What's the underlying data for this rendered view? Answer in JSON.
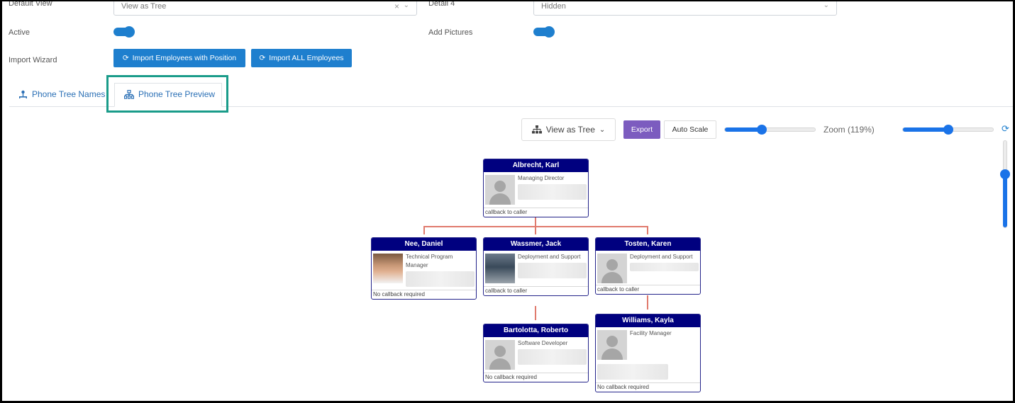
{
  "form": {
    "default_view_label": "Default View",
    "default_view_value": "View as Tree",
    "detail4_label": "Detail 4",
    "detail4_value": "Hidden",
    "active_label": "Active",
    "add_pictures_label": "Add Pictures",
    "import_wizard_label": "Import Wizard",
    "import_position_button": "Import Employees with Position",
    "import_all_button": "Import ALL Employees"
  },
  "tabs": [
    {
      "label": "Phone Tree Names"
    },
    {
      "label": "Phone Tree Preview"
    }
  ],
  "toolbar": {
    "view_label": "View as Tree",
    "export_label": "Export",
    "autoscale_label": "Auto Scale",
    "zoom_label": "Zoom (119%)",
    "zoom_percent": 119
  },
  "org": {
    "karl": {
      "name": "Albrecht, Karl",
      "title": "Managing Director",
      "callback": "callback to caller"
    },
    "daniel": {
      "name": "Nee, Daniel",
      "title": "Technical Program Manager",
      "callback": "No callback required"
    },
    "jack": {
      "name": "Wassmer, Jack",
      "title": "Deployment and Support",
      "callback": "callback to caller"
    },
    "karen": {
      "name": "Tosten, Karen",
      "title": "Deployment and Support",
      "callback": "callback to caller"
    },
    "roberto": {
      "name": "Bartolotta, Roberto",
      "title": "Software Developer",
      "callback": "No callback required"
    },
    "kayla": {
      "name": "Williams, Kayla",
      "title": "Facility Manager",
      "callback": "No callback required"
    }
  },
  "colors": {
    "primary": "#1e7fce",
    "export": "#7c5cbf",
    "card_header": "#00007f",
    "connector": "#e07a6d",
    "highlight": "#1a9c8a"
  }
}
